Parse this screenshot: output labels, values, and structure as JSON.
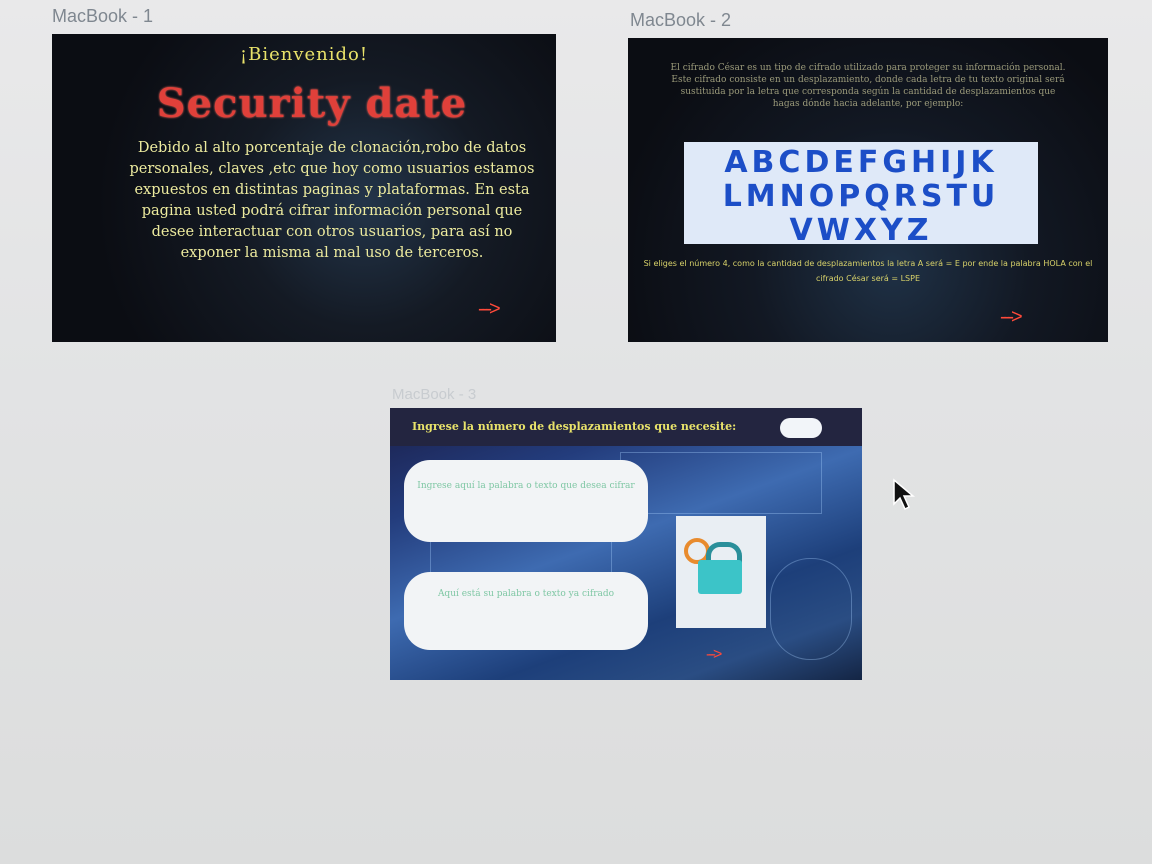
{
  "artboards": [
    {
      "label": "MacBook - 1"
    },
    {
      "label": "MacBook - 2"
    },
    {
      "label": "MacBook - 3"
    }
  ],
  "board1": {
    "welcome": "¡Bienvenido!",
    "title": "Security date",
    "body": "Debido al alto porcentaje de clonación,robo de datos personales, claves ,etc que hoy como usuarios estamos expuestos en distintas paginas y plataformas. En esta pagina usted podrá cifrar información personal que desee interactuar con otros usuarios, para así no exponer la misma al mal uso de terceros.",
    "next_arrow": "--->"
  },
  "board2": {
    "intro": "El cifrado César es un tipo de cifrado utilizado para proteger su información personal. Este cifrado consiste en un desplazamiento, donde cada letra de tu texto original será sustituida por la letra que corresponda según la cantidad de desplazamientos que hagas dónde hacia adelante, por ejemplo:",
    "alphabet_lines": [
      "ABCDEFGHIJK",
      "LMNOPQRSTU",
      "VWXYZ"
    ],
    "footer": "Si eliges el número 4, como la cantidad de desplazamientos la letra A será = E por ende la palabra HOLA con el cifrado César será = LSPE",
    "next_arrow": "--->"
  },
  "board3": {
    "question": "Ingrese la número de desplazamientos que necesite:",
    "input_placeholder": "Ingrese aquí la palabra o texto que desea cifrar",
    "output_placeholder": "Aquí está su palabra o texto ya cifrado",
    "next_arrow": "--->"
  },
  "colors": {
    "accent_red": "#e0403a",
    "text_yellow": "#e8e26a",
    "alphabet_blue": "#1c4ec7"
  },
  "icons": [
    "cursor-arrow-icon",
    "lock-icon",
    "key-icon"
  ]
}
